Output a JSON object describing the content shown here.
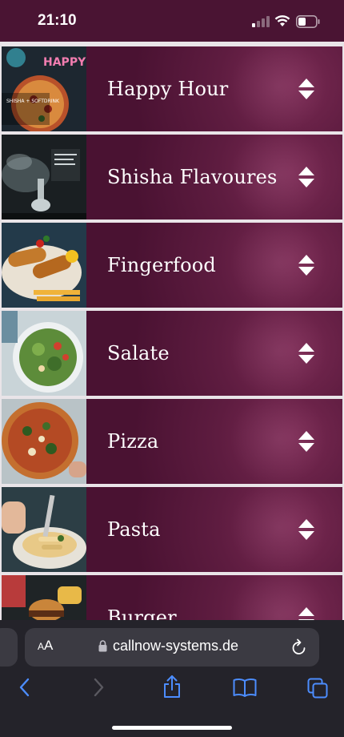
{
  "status_bar": {
    "time": "21:10"
  },
  "menu": {
    "items": [
      {
        "title": "Happy Hour",
        "thumb_text": "HAPPY Hour",
        "thumb_sub": "SHISHA + SOFTDRINK"
      },
      {
        "title": "Shisha Flavoures"
      },
      {
        "title": "Fingerfood"
      },
      {
        "title": "Salate"
      },
      {
        "title": "Pizza"
      },
      {
        "title": "Pasta"
      },
      {
        "title": "Burger"
      }
    ]
  },
  "browser": {
    "aa_label_small": "A",
    "aa_label_large": "A",
    "url": "callnow-systems.de"
  },
  "colors": {
    "band": "#5e1c40",
    "chrome": "#24232a",
    "url_bar": "#3b3a42",
    "safari_blue": "#4c8dff"
  }
}
